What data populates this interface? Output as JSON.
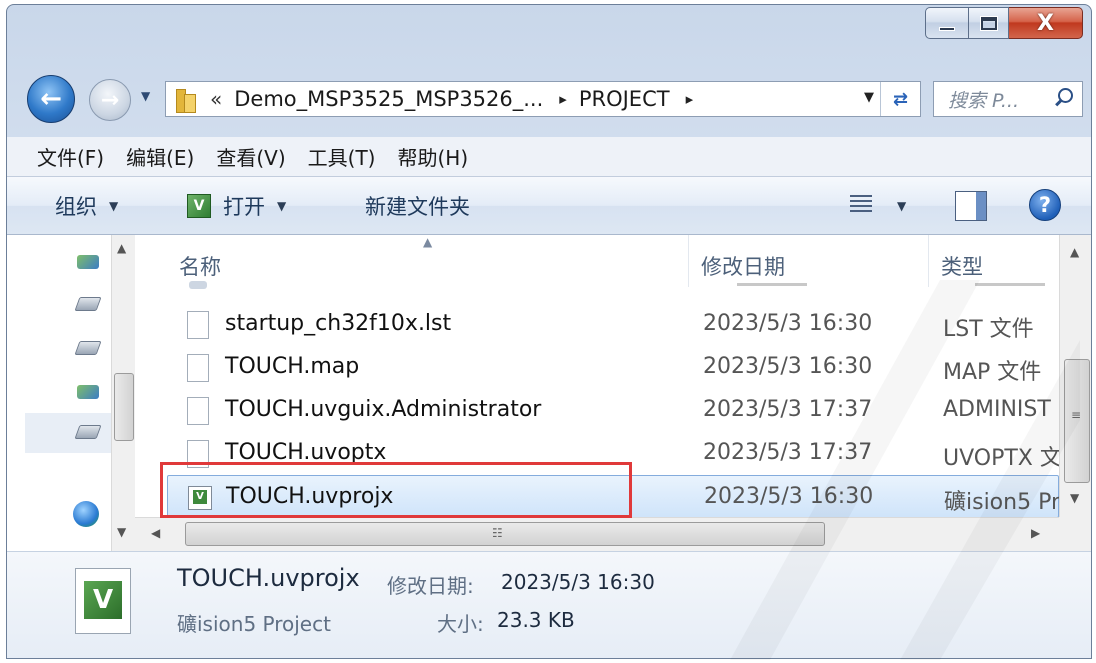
{
  "window": {
    "caption_close": "X"
  },
  "navigation": {
    "breadcrumb_chevron": "«",
    "breadcrumb_path": "Demo_MSP3525_MSP3526_...",
    "breadcrumb_sep1": "▸",
    "breadcrumb_current": "PROJECT",
    "breadcrumb_sep2": "▸",
    "search_placeholder": "搜索 P..."
  },
  "menu": [
    "文件(F)",
    "编辑(E)",
    "查看(V)",
    "工具(T)",
    "帮助(H)"
  ],
  "commands": {
    "organize": "组织",
    "open": "打开",
    "new_folder": "新建文件夹",
    "help": "?"
  },
  "columns": {
    "name": "名称",
    "date": "修改日期",
    "type": "类型"
  },
  "files": [
    {
      "name": "startup_ch32f10x.lst",
      "date": "2023/5/3 16:30",
      "type": "LST 文件"
    },
    {
      "name": "TOUCH.map",
      "date": "2023/5/3 16:30",
      "type": "MAP 文件"
    },
    {
      "name": "TOUCH.uvguix.Administrator",
      "date": "2023/5/3 17:37",
      "type": "ADMINIST"
    },
    {
      "name": "TOUCH.uvoptx",
      "date": "2023/5/3 17:37",
      "type": "UVOPTX 文"
    },
    {
      "name": "TOUCH.uvprojx",
      "date": "2023/5/3 16:30",
      "type": "礦ision5 Pr"
    }
  ],
  "details": {
    "filename": "TOUCH.uvprojx",
    "modified_label": "修改日期:",
    "modified_value": "2023/5/3 16:30",
    "type_value": "礦ision5 Project",
    "size_label": "大小:",
    "size_value": "23.3 KB"
  },
  "colors": {
    "selection": "#cfe4fa",
    "highlight_box": "#e0393a",
    "accent": "#2f79c9"
  }
}
